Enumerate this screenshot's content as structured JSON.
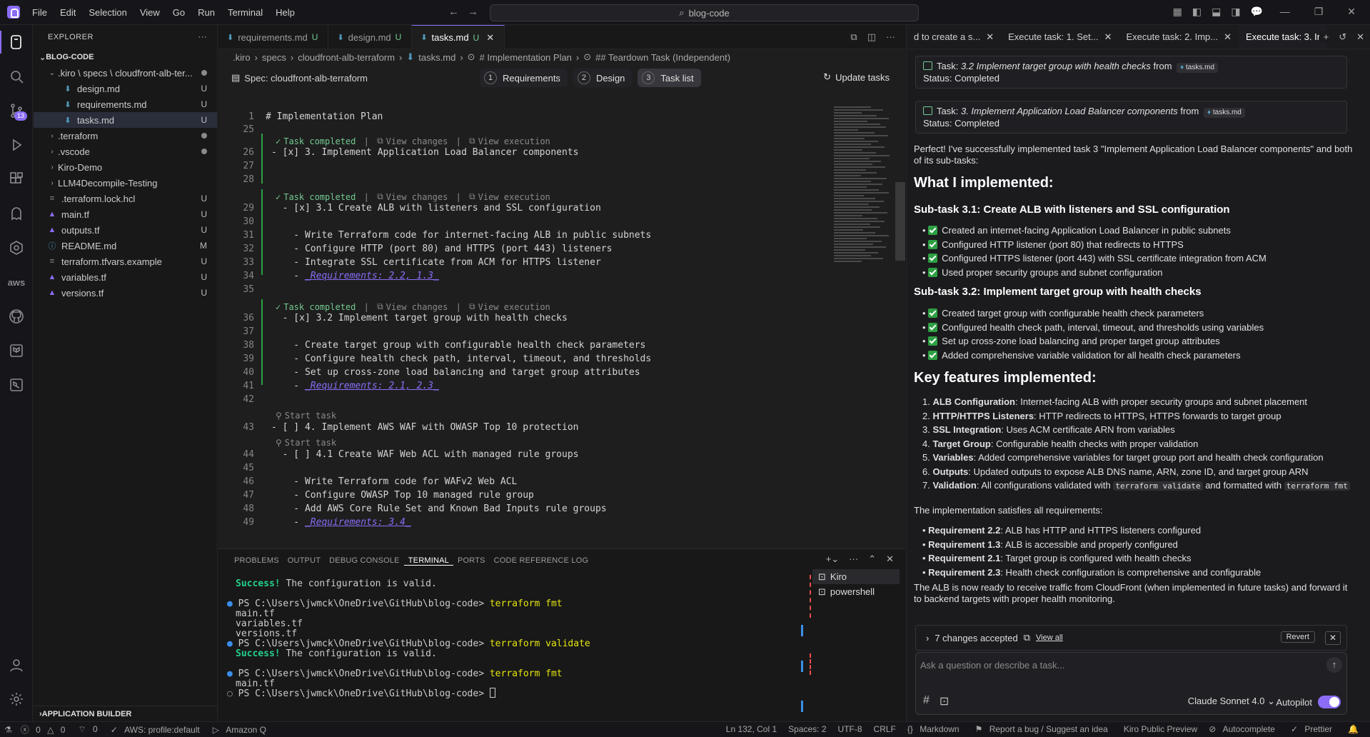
{
  "titlebar": {
    "menu": [
      "File",
      "Edit",
      "Selection",
      "View",
      "Go",
      "Run",
      "Terminal",
      "Help"
    ],
    "search": "blog-code"
  },
  "activity": {
    "scm_badge": "13"
  },
  "explorer": {
    "title": "EXPLORER",
    "root": "BLOG-CODE",
    "items": [
      {
        "label": ".kiro \\ specs \\ cloudfront-alb-ter...",
        "status": "dot"
      },
      {
        "label": "design.md",
        "status": "U"
      },
      {
        "label": "requirements.md",
        "status": "U"
      },
      {
        "label": "tasks.md",
        "status": "U"
      },
      {
        "label": ".terraform",
        "status": "dot"
      },
      {
        "label": ".vscode",
        "status": "dot"
      },
      {
        "label": "Kiro-Demo",
        "status": ""
      },
      {
        "label": "LLM4Decompile-Testing",
        "status": ""
      },
      {
        "label": ".terraform.lock.hcl",
        "status": "U"
      },
      {
        "label": "main.tf",
        "status": "U"
      },
      {
        "label": "outputs.tf",
        "status": "U"
      },
      {
        "label": "README.md",
        "status": "M"
      },
      {
        "label": "terraform.tfvars.example",
        "status": "U"
      },
      {
        "label": "variables.tf",
        "status": "U"
      },
      {
        "label": "versions.tf",
        "status": "U"
      }
    ],
    "app_builder": "APPLICATION BUILDER"
  },
  "editor": {
    "tabs": [
      {
        "label": "requirements.md",
        "status": "U"
      },
      {
        "label": "design.md",
        "status": "U"
      },
      {
        "label": "tasks.md",
        "status": "U"
      }
    ],
    "breadcrumb": [
      ".kiro",
      "specs",
      "cloudfront-alb-terraform",
      "tasks.md",
      "# Implementation Plan",
      "## Teardown Task (Independent)"
    ],
    "spec_title": "Spec: cloudfront-alb-terraform",
    "steps": [
      {
        "n": "1",
        "label": "Requirements"
      },
      {
        "n": "2",
        "label": "Design"
      },
      {
        "n": "3",
        "label": "Task list"
      }
    ],
    "update": "Update tasks",
    "lens_completed": "Task completed",
    "lens_view_changes": "View changes",
    "lens_view_execution": "View execution",
    "lens_start": "Start task",
    "lines": [
      {
        "n": "1",
        "t": "# Implementation Plan"
      },
      {
        "n": "25",
        "t": ""
      },
      {
        "n": "26",
        "t": "- [x] 3. Implement Application Load Balancer components"
      },
      {
        "n": "27",
        "t": ""
      },
      {
        "n": "28",
        "t": ""
      },
      {
        "n": "29",
        "t": "  - [x] 3.1 Create ALB with listeners and SSL configuration"
      },
      {
        "n": "30",
        "t": ""
      },
      {
        "n": "31",
        "t": "    - Write Terraform code for internet-facing ALB in public subnets"
      },
      {
        "n": "32",
        "t": "    - Configure HTTP (port 80) and HTTPS (port 443) listeners"
      },
      {
        "n": "33",
        "t": "    - Integrate SSL certificate from ACM for HTTPS listener"
      },
      {
        "n": "34",
        "t": "    - _Requirements: 2.2, 1.3_"
      },
      {
        "n": "35",
        "t": ""
      },
      {
        "n": "36",
        "t": "  - [x] 3.2 Implement target group with health checks"
      },
      {
        "n": "37",
        "t": ""
      },
      {
        "n": "38",
        "t": "    - Create target group with configurable health check parameters"
      },
      {
        "n": "39",
        "t": "    - Configure health check path, interval, timeout, and thresholds"
      },
      {
        "n": "40",
        "t": "    - Set up cross-zone load balancing and target group attributes"
      },
      {
        "n": "41",
        "t": "    - _Requirements: 2.1, 2.3_"
      },
      {
        "n": "42",
        "t": ""
      },
      {
        "n": "43",
        "t": "- [ ] 4. Implement AWS WAF with OWASP Top 10 protection"
      },
      {
        "n": "44",
        "t": "  - [ ] 4.1 Create WAF Web ACL with managed rule groups"
      },
      {
        "n": "45",
        "t": ""
      },
      {
        "n": "46",
        "t": "    - Write Terraform code for WAFv2 Web ACL"
      },
      {
        "n": "47",
        "t": "    - Configure OWASP Top 10 managed rule group"
      },
      {
        "n": "48",
        "t": "    - Add AWS Core Rule Set and Known Bad Inputs rule groups"
      },
      {
        "n": "49",
        "t": "    - _Requirements: 3.4_"
      }
    ]
  },
  "panel": {
    "tabs": [
      "PROBLEMS",
      "OUTPUT",
      "DEBUG CONSOLE",
      "TERMINAL",
      "PORTS",
      "CODE REFERENCE LOG"
    ],
    "terminal": [
      {
        "k": "ok",
        "a": "Success!",
        "b": " The configuration is valid."
      },
      {
        "k": "blank"
      },
      {
        "k": "cmd",
        "a": "PS C:\\Users\\jwmck\\OneDrive\\GitHub\\blog-code> ",
        "b": "terraform fmt"
      },
      {
        "k": "out",
        "a": "main.tf"
      },
      {
        "k": "out",
        "a": "variables.tf"
      },
      {
        "k": "out",
        "a": "versions.tf"
      },
      {
        "k": "cmd",
        "a": "PS C:\\Users\\jwmck\\OneDrive\\GitHub\\blog-code> ",
        "b": "terraform validate"
      },
      {
        "k": "ok",
        "a": "Success!",
        "b": " The configuration is valid."
      },
      {
        "k": "blank"
      },
      {
        "k": "cmd",
        "a": "PS C:\\Users\\jwmck\\OneDrive\\GitHub\\blog-code> ",
        "b": "terraform fmt"
      },
      {
        "k": "out",
        "a": "main.tf"
      },
      {
        "k": "prompt",
        "a": "PS C:\\Users\\jwmck\\OneDrive\\GitHub\\blog-code> "
      }
    ],
    "term_list": [
      "Kiro",
      "powershell"
    ]
  },
  "chat": {
    "tabs": [
      "d to create a s...",
      "Execute task: 1. Set...",
      "Execute task: 2. Imp...",
      "Execute task: 3. Ir"
    ],
    "cards": [
      {
        "pre": "Task: ",
        "task": "3.2 Implement target group with health checks",
        "from": " from ",
        "file": "tasks.md",
        "status": "Status: Completed"
      },
      {
        "pre": "Task: ",
        "task": "3. Implement Application Load Balancer components",
        "from": " from ",
        "file": "tasks.md",
        "status": "Status: Completed"
      }
    ],
    "intro": "Perfect! I've successfully implemented task 3 \"Implement Application Load Balancer components\" and both of its sub-tasks:",
    "h_impl": "What I implemented:",
    "sub1": "Sub-task 3.1: Create ALB with listeners and SSL configuration",
    "sub1_items": [
      "Created an internet-facing Application Load Balancer in public subnets",
      "Configured HTTP listener (port 80) that redirects to HTTPS",
      "Configured HTTPS listener (port 443) with SSL certificate integration from ACM",
      "Used proper security groups and subnet configuration"
    ],
    "sub2": "Sub-task 3.2: Implement target group with health checks",
    "sub2_items": [
      "Created target group with configurable health check parameters",
      "Configured health check path, interval, timeout, and thresholds using variables",
      "Set up cross-zone load balancing and proper target group attributes",
      "Added comprehensive variable validation for all health check parameters"
    ],
    "h_key": "Key features implemented:",
    "key_items": [
      {
        "b": "ALB Configuration",
        "t": ": Internet-facing ALB with proper security groups and subnet placement"
      },
      {
        "b": "HTTP/HTTPS Listeners",
        "t": ": HTTP redirects to HTTPS, HTTPS forwards to target group"
      },
      {
        "b": "SSL Integration",
        "t": ": Uses ACM certificate ARN from variables"
      },
      {
        "b": "Target Group",
        "t": ": Configurable health checks with proper validation"
      },
      {
        "b": "Variables",
        "t": ": Added comprehensive variables for target group port and health check configuration"
      },
      {
        "b": "Outputs",
        "t": ": Updated outputs to expose ALB DNS name, ARN, zone ID, and target group ARN"
      }
    ],
    "key7_b": "Validation",
    "key7_t": ": All configurations validated with ",
    "key7_c1": "terraform validate",
    "key7_t2": " and formatted with ",
    "key7_c2": "terraform fmt",
    "satisfies": "The implementation satisfies all requirements:",
    "req_items": [
      {
        "b": "Requirement 2.2",
        "t": ": ALB has HTTP and HTTPS listeners configured"
      },
      {
        "b": "Requirement 1.3",
        "t": ": ALB is accessible and properly configured"
      },
      {
        "b": "Requirement 2.1",
        "t": ": Target group is configured with health checks"
      },
      {
        "b": "Requirement 2.3",
        "t": ": Health check configuration is comprehensive and configurable"
      }
    ],
    "closing": "The ALB is now ready to receive traffic from CloudFront (when implemented in future tasks) and forward it to backend targets with proper health monitoring.",
    "changes": "7 changes accepted",
    "view_all": "View all",
    "revert": "Revert",
    "placeholder": "Ask a question or describe a task...",
    "model": "Claude Sonnet 4.0",
    "autopilot": "Autopilot"
  },
  "status": {
    "errors": "0",
    "warnings": "0",
    "ports": "0",
    "aws": "AWS: profile:default",
    "amazonq": "Amazon Q",
    "pos": "Ln 132, Col 1",
    "spaces": "Spaces: 2",
    "enc": "UTF-8",
    "eol": "CRLF",
    "lang": "Markdown",
    "report": "Report a bug / Suggest an idea",
    "preview": "Kiro Public Preview",
    "autocomplete": "Autocomplete",
    "prettier": "Prettier"
  }
}
